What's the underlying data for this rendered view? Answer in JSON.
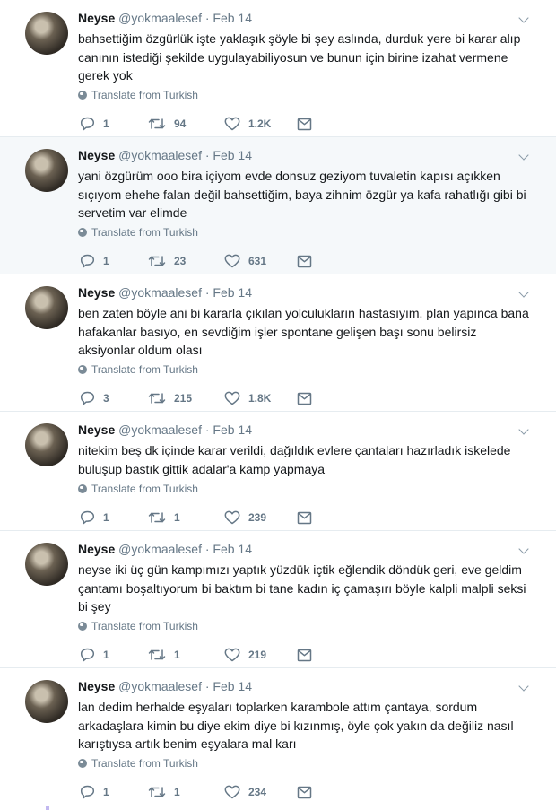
{
  "colors": {
    "thread_line": "#c2b8f0",
    "highlight_bg": "#f5f8fa",
    "muted_text": "#657786",
    "primary_text": "#14171a"
  },
  "icons": [
    "reply-icon",
    "retweet-icon",
    "like-icon",
    "direct-message-icon",
    "globe-icon",
    "caret-down-icon",
    "avatar"
  ],
  "tweets": [
    {
      "name": "Neyse",
      "handle": "@yokmaalesef",
      "date": "· Feb 14",
      "text": "bahsettiğim özgürlük işte yaklaşık şöyle bi şey aslında, durduk yere bi karar alıp canının istediği şekilde uygulayabiliyosun ve bunun için birine izahat vermene gerek yok",
      "translate": "Translate from Turkish",
      "replies": "1",
      "retweets": "94",
      "likes": "1.2K"
    },
    {
      "name": "Neyse",
      "handle": "@yokmaalesef",
      "date": "· Feb 14",
      "text": "yani özgürüm ooo bira içiyom evde donsuz geziyom tuvaletin kapısı açıkken sıçıyom ehehe falan değil bahsettiğim, baya zihnim özgür ya kafa rahatlığı gibi bi servetim var elimde",
      "translate": "Translate from Turkish",
      "replies": "1",
      "retweets": "23",
      "likes": "631"
    },
    {
      "name": "Neyse",
      "handle": "@yokmaalesef",
      "date": "· Feb 14",
      "text": "ben zaten böyle ani bi kararla çıkılan yolculukların hastasıyım. plan yapınca bana hafakanlar basıyo, en sevdiğim işler spontane gelişen başı sonu belirsiz aksiyonlar oldum olası",
      "translate": "Translate from Turkish",
      "replies": "3",
      "retweets": "215",
      "likes": "1.8K"
    },
    {
      "name": "Neyse",
      "handle": "@yokmaalesef",
      "date": "· Feb 14",
      "text": "nitekim beş dk içinde karar verildi, dağıldık evlere çantaları hazırladık iskelede buluşup bastık gittik adalar'a kamp yapmaya",
      "translate": "Translate from Turkish",
      "replies": "1",
      "retweets": "1",
      "likes": "239"
    },
    {
      "name": "Neyse",
      "handle": "@yokmaalesef",
      "date": "· Feb 14",
      "text": "neyse iki üç gün kampımızı yaptık yüzdük içtik eğlendik döndük geri, eve geldim çantamı boşaltıyorum bi baktım bi tane kadın iç çamaşırı böyle kalpli malpli seksi bi şey",
      "translate": "Translate from Turkish",
      "replies": "1",
      "retweets": "1",
      "likes": "219"
    },
    {
      "name": "Neyse",
      "handle": "@yokmaalesef",
      "date": "· Feb 14",
      "text": "lan dedim herhalde eşyaları toplarken karambole attım çantaya, sordum arkadaşlara kimin bu diye ekim diye bi kızınmış, öyle çok yakın da değiliz nasıl karıştıysa artık benim eşyalara mal karı",
      "translate": "Translate from Turkish",
      "replies": "1",
      "retweets": "1",
      "likes": "234"
    }
  ]
}
